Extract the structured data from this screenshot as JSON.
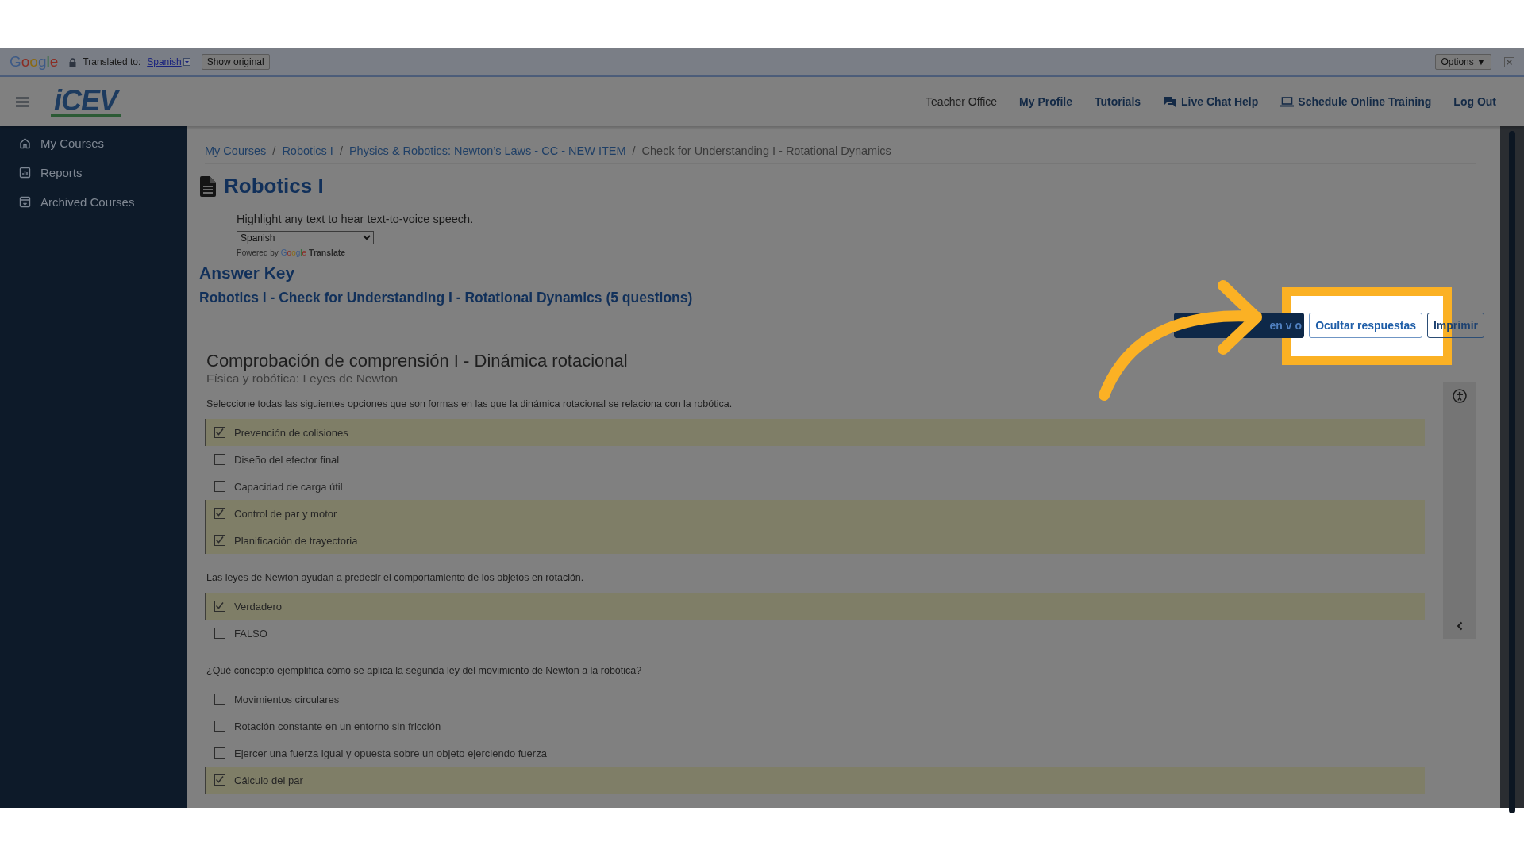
{
  "translate_bar": {
    "brand": "Google",
    "label": "Translated to:",
    "language": "Spanish",
    "show_original": "Show original",
    "options": "Options ▼"
  },
  "header": {
    "logo": "iCEV",
    "nav": [
      {
        "label": "Teacher Office",
        "kind": "plain"
      },
      {
        "label": "My Profile",
        "kind": "bold"
      },
      {
        "label": "Tutorials",
        "kind": "bold"
      },
      {
        "label": "Live Chat Help",
        "kind": "chat"
      },
      {
        "label": "Schedule Online Training",
        "kind": "training"
      },
      {
        "label": "Log Out",
        "kind": "bold"
      }
    ]
  },
  "sidebar": {
    "items": [
      {
        "label": "My Courses",
        "kind": "home"
      },
      {
        "label": "Reports",
        "kind": "reports"
      },
      {
        "label": "Archived Courses",
        "kind": "archive"
      }
    ]
  },
  "breadcrumb_separator": "/",
  "breadcrumb": [
    {
      "label": "My Courses",
      "link": true
    },
    {
      "label": "Robotics I",
      "link": true
    },
    {
      "label": "Physics & Robotics: Newton’s Laws - CC - NEW ITEM",
      "link": true
    },
    {
      "label": "Check for Understanding I - Rotational Dynamics",
      "link": false
    }
  ],
  "page_title": "Robotics I",
  "speech": {
    "hint": "Highlight any text to hear text-to-voice speech.",
    "language": "Spanish",
    "powered_by": "Powered by",
    "brand": "Google",
    "product": "Translate"
  },
  "answer_key": "Answer Key",
  "assessment_title": "Robotics I - Check for Understanding I - Rotational Dynamics (5 questions)",
  "actions": [
    {
      "kind": "primary",
      "label_parts": [
        "en v",
        "o"
      ],
      "highlighted": false
    },
    {
      "kind": "outline",
      "label": "Ocultar respuestas",
      "highlighted": true
    },
    {
      "kind": "outline",
      "label": "Imprimir",
      "highlighted": false
    }
  ],
  "quiz": {
    "title": "Comprobación de comprensión I - Dinámica rotacional",
    "subtitle": "Física y robótica: Leyes de Newton",
    "questions": [
      {
        "prompt": "Seleccione todas las siguientes opciones que son formas en las que la dinámica rotacional se relaciona con la robótica.",
        "options": [
          {
            "label": "Prevención de colisiones",
            "checked": true
          },
          {
            "label": "Diseño del efector final",
            "checked": false
          },
          {
            "label": "Capacidad de carga útil",
            "checked": false
          },
          {
            "label": "Control de par y motor",
            "checked": true
          },
          {
            "label": "Planificación de trayectoria",
            "checked": true
          }
        ]
      },
      {
        "prompt": "Las leyes de Newton ayudan a predecir el comportamiento de los objetos en rotación.",
        "options": [
          {
            "label": "Verdadero",
            "checked": true
          },
          {
            "label": "FALSO",
            "checked": false
          }
        ]
      },
      {
        "prompt": "¿Qué concepto ejemplifica cómo se aplica la segunda ley del movimiento de Newton a la robótica?",
        "options": [
          {
            "label": "Movimientos circulares",
            "checked": false
          },
          {
            "label": "Rotación constante en un entorno sin fricción",
            "checked": false
          },
          {
            "label": "Ejercer una fuerza igual y opuesta sobre un objeto ejerciendo fuerza",
            "checked": false
          },
          {
            "label": "Cálculo del par",
            "checked": true
          }
        ]
      }
    ]
  }
}
